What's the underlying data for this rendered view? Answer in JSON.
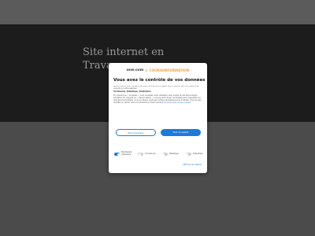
{
  "page": {
    "title_line1": "Site  internet en",
    "title_line2": "Travau"
  },
  "consent": {
    "brand": "one.com",
    "brand_separator": "×",
    "partner": "COOKIEINFORMATION",
    "title": "Vous avez le contrôle de vos données",
    "paragraphs": [
      "Nous utilisons des cookies, ainsi que d'autres technologies, pour collecter des informations sur vous et sur votre appareil.",
      "Fonctionnel, Statistique, Publicitaire",
      "En cliquant sur « Accepter », vous acceptez notre utilisation des cookies et des technologies similaires. En cliquant sur « Personnaliser », vous pouvez choisir les finalités pour lesquelles vos données sont traitées. Si vous refusez, seuls les cookies nécessaires seront utilisés. Vous pouvez modifier ou retirer votre consentement à tout moment."
    ],
    "read_more": "En savoir plus sur les cookies",
    "customize_button": "Personnaliser",
    "accept_button": "Tout accepter",
    "toggles": [
      {
        "label": "Strictement nécessaire",
        "on": true
      },
      {
        "label": "Fonctionnel",
        "on": false
      },
      {
        "label": "Statistique",
        "on": false
      },
      {
        "label": "Publicitaire",
        "on": false
      }
    ],
    "details_link": "Afficher les détails",
    "colors": {
      "accent": "#1e7bd8",
      "partner": "#f2a23c"
    }
  }
}
